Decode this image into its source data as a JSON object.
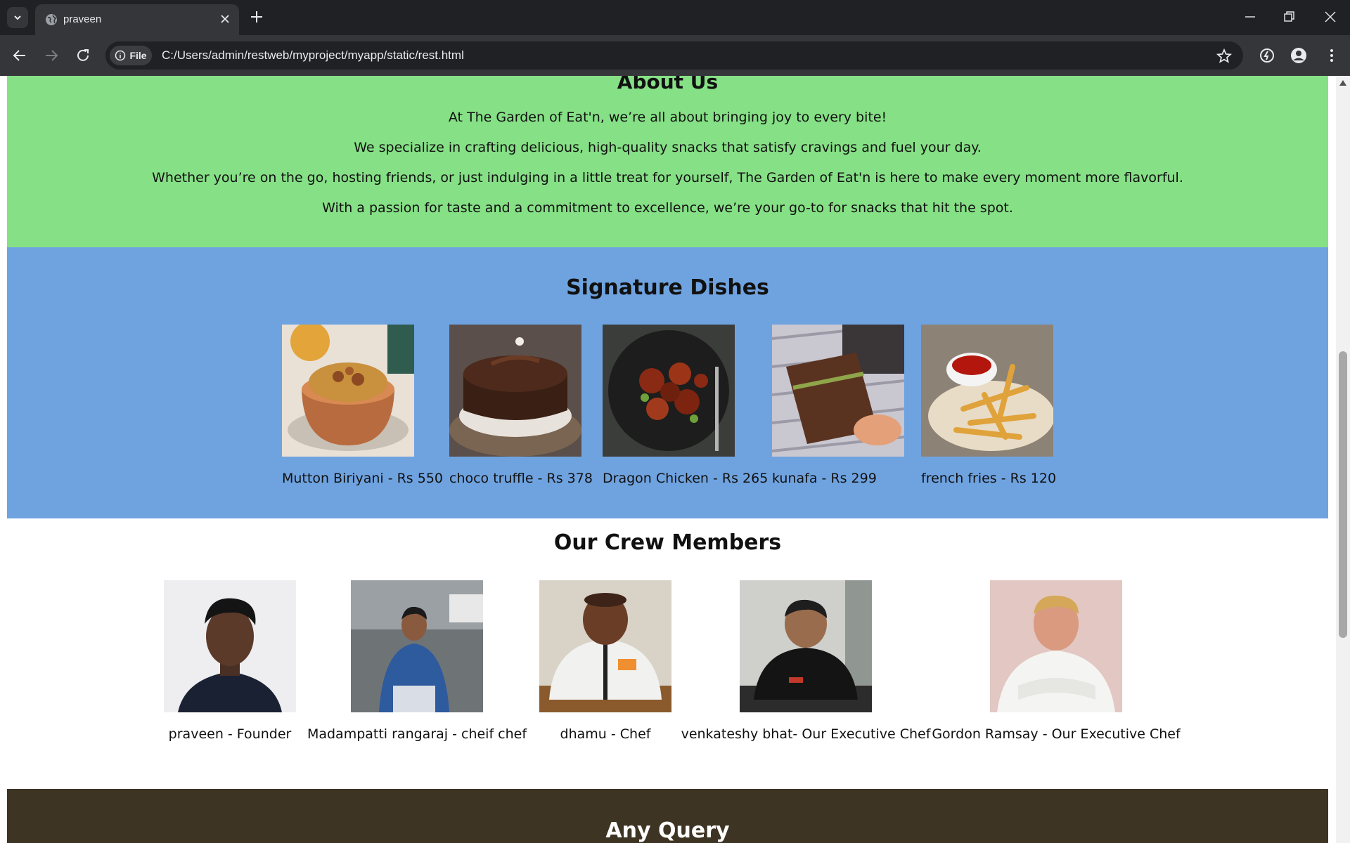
{
  "browser": {
    "tab_title": "praveen",
    "omnibox_chip": "File",
    "url": "C:/Users/admin/restweb/myproject/myapp/static/rest.html",
    "icons": [
      "tab-list-icon",
      "globe-icon",
      "close-icon",
      "plus-icon",
      "minimize-icon",
      "restore-icon",
      "close-window-icon",
      "back-icon",
      "forward-icon",
      "reload-icon",
      "info-icon",
      "star-icon",
      "extension-icon",
      "profile-icon",
      "menu-icon"
    ]
  },
  "about": {
    "heading": "About Us",
    "paragraphs": [
      "At The Garden of Eat'n, we’re all about bringing joy to every bite!",
      "We specialize in crafting delicious, high-quality snacks that satisfy cravings and fuel your day.",
      "Whether you’re on the go, hosting friends, or just indulging in a little treat for yourself, The Garden of Eat'n is here to make every moment more flavorful.",
      "With a passion for taste and a commitment to excellence, we’re your go-to for snacks that hit the spot."
    ]
  },
  "dishes": {
    "heading": "Signature Dishes",
    "items": [
      {
        "caption": "Mutton Biriyani - Rs 550"
      },
      {
        "caption": "choco truffle - Rs 378"
      },
      {
        "caption": "Dragon Chicken - Rs 265"
      },
      {
        "caption": "kunafa - Rs 299"
      },
      {
        "caption": "french fries - Rs 120"
      }
    ]
  },
  "crew": {
    "heading": "Our Crew Members",
    "members": [
      {
        "caption": "praveen - Founder"
      },
      {
        "caption": "Madampatti rangaraj - cheif chef"
      },
      {
        "caption": "dhamu - Chef"
      },
      {
        "caption": "venkateshy bhat- Our Executive Chef"
      },
      {
        "caption": "Gordon Ramsay - Our Executive Chef"
      }
    ]
  },
  "query": {
    "heading": "Any Query"
  },
  "colors": {
    "about_bg": "#86e086",
    "dishes_bg": "#6fa3e0",
    "query_bg": "#3e3424",
    "chrome_dark": "#202124",
    "chrome_toolbar": "#35363a"
  }
}
